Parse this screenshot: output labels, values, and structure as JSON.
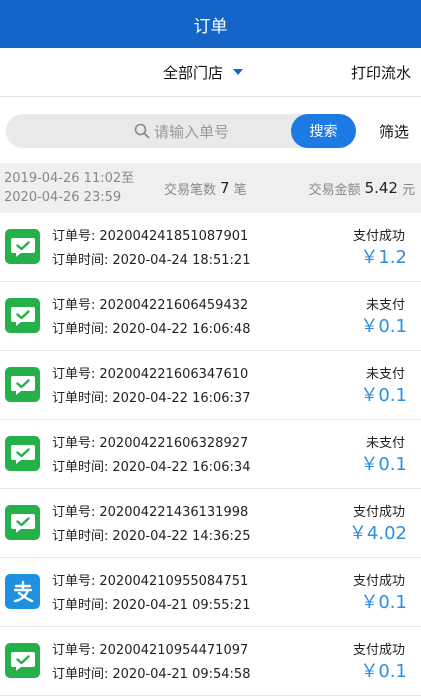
{
  "header": {
    "title": "订单"
  },
  "subbar": {
    "store": "全部门店",
    "print": "打印流水"
  },
  "search": {
    "placeholder": "请输入单号",
    "button": "搜索",
    "filter": "筛选"
  },
  "summary": {
    "start": "2019-04-26 11:02至",
    "end": "2020-04-26 23:59",
    "count_label": "交易笔数",
    "count": "7",
    "count_unit": "笔",
    "amount_label": "交易金额",
    "amount": "5.42",
    "amount_unit": "元"
  },
  "labels": {
    "order_no": "订单号:",
    "order_time": "订单时间:"
  },
  "orders": [
    {
      "id": "202004241851087901",
      "time": "2020-04-24 18:51:21",
      "status": "支付成功",
      "amount": "￥1.2",
      "pay": "wechat"
    },
    {
      "id": "202004221606459432",
      "time": "2020-04-22 16:06:48",
      "status": "未支付",
      "amount": "￥0.1",
      "pay": "wechat"
    },
    {
      "id": "202004221606347610",
      "time": "2020-04-22 16:06:37",
      "status": "未支付",
      "amount": "￥0.1",
      "pay": "wechat"
    },
    {
      "id": "202004221606328927",
      "time": "2020-04-22 16:06:34",
      "status": "未支付",
      "amount": "￥0.1",
      "pay": "wechat"
    },
    {
      "id": "202004221436131998",
      "time": "2020-04-22 14:36:25",
      "status": "支付成功",
      "amount": "￥4.02",
      "pay": "wechat"
    },
    {
      "id": "202004210955084751",
      "time": "2020-04-21 09:55:21",
      "status": "支付成功",
      "amount": "￥0.1",
      "pay": "alipay"
    },
    {
      "id": "202004210954471097",
      "time": "2020-04-21 09:54:58",
      "status": "支付成功",
      "amount": "￥0.1",
      "pay": "wechat"
    }
  ],
  "colors": {
    "primary": "#1565c9",
    "button": "#1c7ae4",
    "wechat": "#24b14a",
    "alipay": "#1f8fe0",
    "amount": "#2c8fe0"
  }
}
